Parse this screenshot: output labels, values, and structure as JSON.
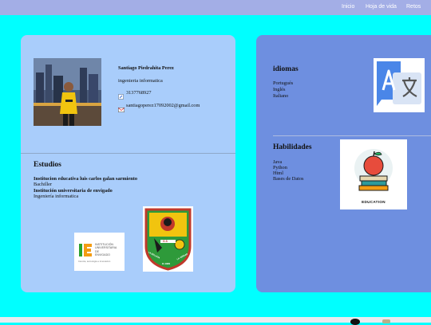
{
  "nav": {
    "items": [
      "Inicio",
      "Hoja de vida",
      "Retos"
    ]
  },
  "profile": {
    "name": "Santiago Piedrahita Perez",
    "profession": "ingenieria informatica",
    "phone": "3137768927",
    "email": "santiagoperez17092002@gmail.com"
  },
  "estudios": {
    "title": "Estudios",
    "school": "Institucion educativa luis carlos galan sarmiento",
    "school_degree": "Bachiller",
    "university": "Institución universitaria de envigado",
    "university_degree": "Ingeniería informatica",
    "logo_iue": {
      "lines": [
        "INSTITUCIÓN",
        "UNIVERSITARIA",
        "DE",
        "ENVIGADO"
      ],
      "tagline": "Ciencia, tecnología e innovación"
    },
    "logo_school": {
      "motto": [
        "LA BELLEZA",
        "EL BIEN",
        "LA VERDAD"
      ],
      "letters": "G.S"
    }
  },
  "idiomas": {
    "title": "idiomas",
    "items": [
      "Portugués",
      "Inglés",
      "Italiano"
    ],
    "icon": "translate-icon"
  },
  "habilidades": {
    "title": "Habilidades",
    "items": [
      "Java",
      "Python",
      "Html",
      "Bases de Datos"
    ],
    "image_caption": "EDUCATION"
  },
  "colors": {
    "background": "#00ffff",
    "topbar": "#a3aee6",
    "left_card": "#a9cdfb",
    "right_card": "#6e8fe0",
    "translate_blue": "#4a86e8"
  }
}
